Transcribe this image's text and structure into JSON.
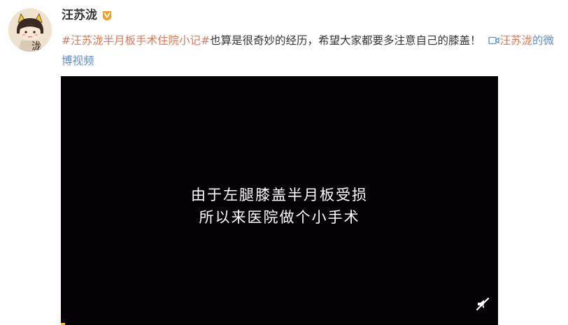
{
  "user": {
    "name": "汪苏泷",
    "avatar_icon": "avatar-cartoon-icon",
    "avatar_text": "泷",
    "verified_icon": "verified-badge-icon",
    "verified_color": "#f5a623"
  },
  "post": {
    "topic": "#汪苏泷半月板手术住院小记#",
    "body": "也算是很奇妙的经历，希望大家都要多注意自己的膝盖！",
    "video_link_icon": "video-link-icon",
    "video_link_name": "汪苏泷",
    "video_link_suffix": "的微博视频"
  },
  "video": {
    "subtitle_line1": "由于左腿膝盖半月板受损",
    "subtitle_line2": "所以来医院做个小手术",
    "mute_icon": "mute-icon",
    "progress": 0.01
  },
  "colors": {
    "topic": "#eb7350",
    "link": "#5b8bd6",
    "video_bg": "#050205"
  }
}
